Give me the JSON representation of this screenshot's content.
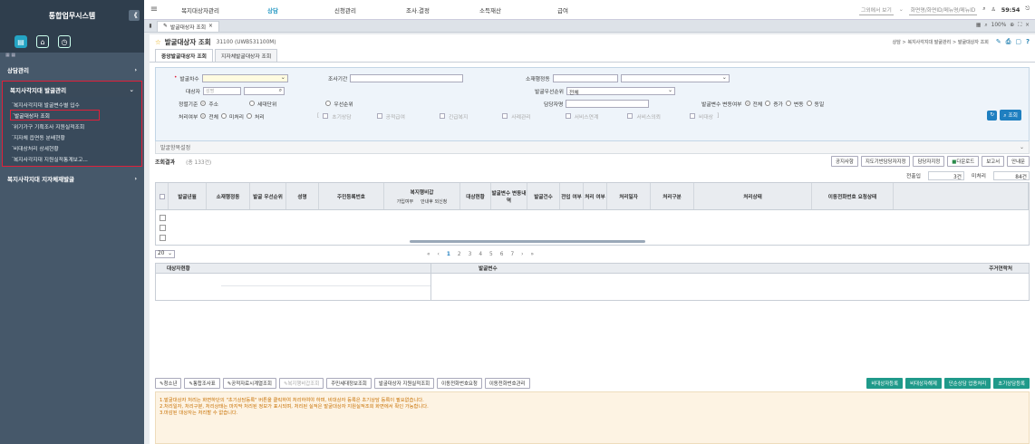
{
  "sidebar": {
    "title": "통합업무시스템",
    "collapse": "《",
    "section_header": "상담관리",
    "group_title": "복지사각지대 발굴관리",
    "items": [
      "복지사각지대 발굴변수별 입수",
      "발굴대상자 조회",
      "위기가구 기획조사 지원실적조회",
      "지자체 읍면동 분배현황",
      "비대상처리 상세현황",
      "복지사각지대 지원실적통계보고..."
    ],
    "next_group": "복지사각지대 지자체재발굴"
  },
  "topnav": {
    "items": [
      "복지대상자관리",
      "상담",
      "신청관리",
      "조사.결정",
      "소득재산",
      "급여"
    ],
    "active_index": 1,
    "user": "그외에서 보기",
    "org": "화면명/화면ID/메뉴명/메뉴ID",
    "clock": "59:54"
  },
  "tabbar": {
    "tab_label": "발굴대상자 조회",
    "zoom": "100%"
  },
  "page": {
    "title": "발굴대상자 조회",
    "code": "31100 (UWB531100M)",
    "breadcrumb": "상담 > 복지사각지대 발굴관리 > 발굴대상자 조회"
  },
  "subtabs": [
    "중앙발굴대상자 조회",
    "지자체발굴대상자 조회"
  ],
  "filter": {
    "l_balgul": "발굴차수",
    "l_period": "조사기간",
    "l_admin": "소재행정동",
    "l_subject": "대상자",
    "subject_placeholder": "성명",
    "l_priority": "발굴우선순위",
    "priority_value": "전체",
    "l_basis": "정렬기준",
    "basis_opts": [
      "주소",
      "세대단위",
      "우선순위"
    ],
    "l_manager": "담당자명",
    "l_change": "발굴변수 변동여부",
    "change_opts": [
      "전체",
      "증가",
      "변동",
      "동일"
    ],
    "l_proc": "처리여부",
    "proc_opts": [
      "전체",
      "미처리",
      "처리"
    ],
    "checks": [
      "초기상담",
      "공적급여",
      "긴급복지",
      "사례관리",
      "서비스연계",
      "서비스의뢰",
      "비대상"
    ],
    "search": "조회"
  },
  "section": {
    "label": "발굴항목설정"
  },
  "results": {
    "title": "조회결과",
    "count": "(총 133건)",
    "buttons": [
      "공지사항",
      "지도기반담당자지정",
      "담당자지정",
      "다운로드",
      "보고서",
      "안내문"
    ],
    "sum_label1": "전출입",
    "sum_val1": "3건",
    "sum_label2": "미처리",
    "sum_val2": "84건"
  },
  "grid": {
    "headers": [
      "발굴년월",
      "소재행정동",
      "발굴 우선순위",
      "성명",
      "주민등록번호",
      "복지행비갑",
      "대상현황",
      "발굴변수 변동내역",
      "발굴건수",
      "전입 여부",
      "처리 여부",
      "처리일자",
      "처리구분",
      "처리상태",
      "이동전화번호 요청상태"
    ],
    "sub_headers": [
      "가입여부",
      "안내후 외신청"
    ]
  },
  "pager": {
    "page_size": "20",
    "pages": [
      "«",
      "‹",
      "1",
      "2",
      "3",
      "4",
      "5",
      "6",
      "7",
      "›",
      "»"
    ]
  },
  "subgrid": {
    "h1": "대상자현황",
    "h2": "발굴변수",
    "h3": "주거연락처"
  },
  "bottom": {
    "left_buttons": [
      "청소년",
      "통합조사표",
      "공적자료시계열조회",
      "복지행비갑조회",
      "주민세대정보조회",
      "발굴대상자 지원실적조회",
      "이동전화번호요청",
      "이동전화번호관리"
    ],
    "right_buttons": [
      "비대상자등록",
      "비대상자해제",
      "단순상담 업종처리",
      "초기상담등록"
    ]
  },
  "notice": {
    "lines": [
      "1.발굴대상자 처리는 화면하단의 \"초기상담등록\" 버튼을 클릭하여 처리하여야 하며, 비대상자 등록은 초기상담 등록이 필요없습니다.",
      "2.처리일자, 처리구분, 처리상태는 마지막 처리된 정보가 표시되며, 처리된 실적은 발굴대상자 지원실적조회 화면에서 확인 가능합니다.",
      "3.마감된 대상자는 처리할 수 없습니다."
    ]
  }
}
